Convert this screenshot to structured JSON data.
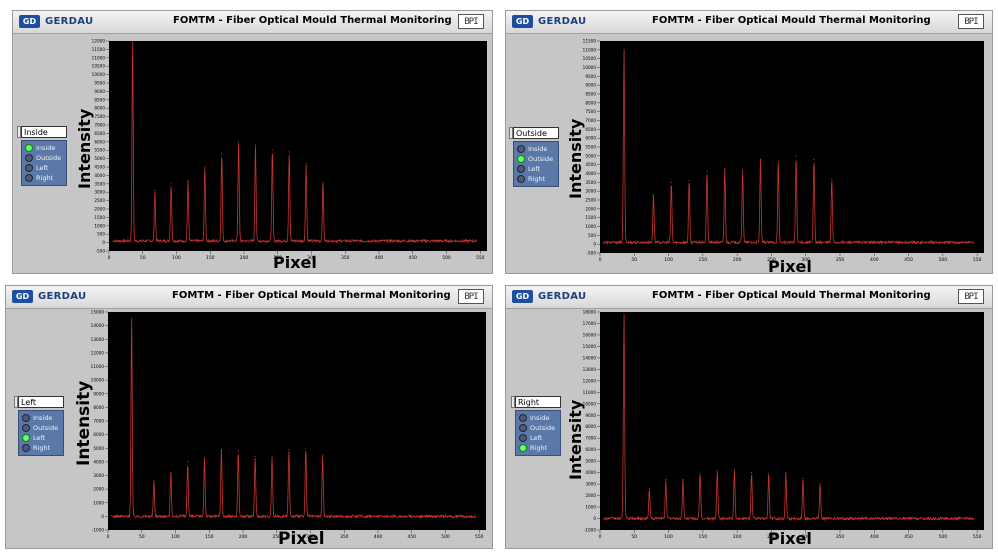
{
  "colors": {
    "plot_bg": "#000000",
    "trace": "#c8352f",
    "tick_text": "#000000"
  },
  "panels": [
    {
      "brand": "GERDAU",
      "logo_text": "GD",
      "title": "FOMTM - Fiber Optical Mould Thermal Monitoring",
      "corner_icon": "BPI-logo-icon",
      "selector": {
        "value": "Inside",
        "options": [
          {
            "label": "Inside",
            "active": true
          },
          {
            "label": "Outside",
            "active": false
          },
          {
            "label": "Left",
            "active": false
          },
          {
            "label": "Right",
            "active": false
          }
        ]
      },
      "chart_data": {
        "type": "line",
        "xlabel": "Pixel",
        "ylabel": "Intensity",
        "xlim": [
          0,
          500
        ],
        "ylim": [
          -500,
          12000
        ],
        "x_ticks": [
          0,
          50,
          100,
          150,
          200,
          250,
          300,
          350,
          400,
          450,
          500,
          550
        ],
        "y_ticks": [
          -500,
          0,
          500,
          1000,
          1500,
          2000,
          2500,
          3000,
          3500,
          4000,
          4500,
          5000,
          5500,
          6000,
          6500,
          7000,
          7500,
          8000,
          8500,
          9000,
          9500,
          10000,
          10500,
          11000,
          11500,
          12000
        ],
        "baseline": 100,
        "peaks": [
          {
            "x": 35,
            "y": 11900
          },
          {
            "x": 68,
            "y": 3100
          },
          {
            "x": 92,
            "y": 3500
          },
          {
            "x": 117,
            "y": 3700
          },
          {
            "x": 142,
            "y": 4500
          },
          {
            "x": 167,
            "y": 5300
          },
          {
            "x": 192,
            "y": 6000
          },
          {
            "x": 217,
            "y": 5800
          },
          {
            "x": 242,
            "y": 5500
          },
          {
            "x": 267,
            "y": 5400
          },
          {
            "x": 292,
            "y": 4700
          },
          {
            "x": 317,
            "y": 3600
          }
        ]
      }
    },
    {
      "brand": "GERDAU",
      "logo_text": "GD",
      "title": "FOMTM - Fiber Optical Mould Thermal Monitoring",
      "corner_icon": "BPI-logo-icon",
      "selector": {
        "value": "Outside",
        "options": [
          {
            "label": "Inside",
            "active": false
          },
          {
            "label": "Outside",
            "active": true
          },
          {
            "label": "Left",
            "active": false
          },
          {
            "label": "Right",
            "active": false
          }
        ]
      },
      "chart_data": {
        "type": "line",
        "xlabel": "Pixel",
        "ylabel": "Intensity",
        "xlim": [
          0,
          500
        ],
        "ylim": [
          -500,
          11500
        ],
        "x_ticks": [
          0,
          50,
          100,
          150,
          200,
          250,
          300,
          350,
          400,
          450,
          500,
          550
        ],
        "y_ticks": [
          -500,
          0,
          500,
          1000,
          1500,
          2000,
          2500,
          3000,
          3500,
          4000,
          4500,
          5000,
          5500,
          6000,
          6500,
          7000,
          7500,
          8000,
          8500,
          9000,
          9500,
          10000,
          10500,
          11000,
          11500
        ],
        "baseline": 100,
        "peaks": [
          {
            "x": 35,
            "y": 11000
          },
          {
            "x": 78,
            "y": 2800
          },
          {
            "x": 104,
            "y": 3500
          },
          {
            "x": 130,
            "y": 3600
          },
          {
            "x": 156,
            "y": 4100
          },
          {
            "x": 182,
            "y": 4300
          },
          {
            "x": 208,
            "y": 4200
          },
          {
            "x": 234,
            "y": 4800
          },
          {
            "x": 260,
            "y": 4700
          },
          {
            "x": 286,
            "y": 5000
          },
          {
            "x": 312,
            "y": 4800
          },
          {
            "x": 338,
            "y": 3700
          }
        ]
      }
    },
    {
      "brand": "GERDAU",
      "logo_text": "GD",
      "title": "FOMTM - Fiber Optical Mould Thermal Monitoring",
      "corner_icon": "BPI-logo-icon",
      "selector": {
        "value": "Left",
        "options": [
          {
            "label": "Inside",
            "active": false
          },
          {
            "label": "Outside",
            "active": false
          },
          {
            "label": "Left",
            "active": true
          },
          {
            "label": "Right",
            "active": false
          }
        ]
      },
      "chart_data": {
        "type": "line",
        "xlabel": "Pixel",
        "ylabel": "Intensity",
        "xlim": [
          0,
          500
        ],
        "ylim": [
          -1000,
          15000
        ],
        "x_ticks": [
          0,
          50,
          100,
          150,
          200,
          250,
          300,
          350,
          400,
          450,
          500,
          550
        ],
        "y_ticks": [
          -1000,
          0,
          1000,
          2000,
          3000,
          4000,
          5000,
          6000,
          7000,
          8000,
          9000,
          10000,
          11000,
          12000,
          13000,
          14000,
          15000
        ],
        "baseline": 0,
        "peaks": [
          {
            "x": 35,
            "y": 14500
          },
          {
            "x": 68,
            "y": 2600
          },
          {
            "x": 93,
            "y": 3200
          },
          {
            "x": 118,
            "y": 4000
          },
          {
            "x": 143,
            "y": 4300
          },
          {
            "x": 168,
            "y": 4900
          },
          {
            "x": 193,
            "y": 4800
          },
          {
            "x": 218,
            "y": 4400
          },
          {
            "x": 243,
            "y": 4400
          },
          {
            "x": 268,
            "y": 4900
          },
          {
            "x": 293,
            "y": 5000
          },
          {
            "x": 318,
            "y": 4500
          }
        ]
      }
    },
    {
      "brand": "GERDAU",
      "logo_text": "GD",
      "title": "FOMTM - Fiber Optical Mould Thermal Monitoring",
      "corner_icon": "BPI-logo-icon",
      "selector": {
        "value": "Right",
        "options": [
          {
            "label": "Inside",
            "active": false
          },
          {
            "label": "Outside",
            "active": false
          },
          {
            "label": "Left",
            "active": false
          },
          {
            "label": "Right",
            "active": true
          }
        ]
      },
      "chart_data": {
        "type": "line",
        "xlabel": "Pixel",
        "ylabel": "Intensity",
        "xlim": [
          0,
          500
        ],
        "ylim": [
          -1000,
          18000
        ],
        "x_ticks": [
          0,
          50,
          100,
          150,
          200,
          250,
          300,
          350,
          400,
          450,
          500,
          550
        ],
        "y_ticks": [
          -1000,
          0,
          1000,
          2000,
          3000,
          4000,
          5000,
          6000,
          7000,
          8000,
          9000,
          10000,
          11000,
          12000,
          13000,
          14000,
          15000,
          16000,
          17000,
          18000
        ],
        "baseline": 0,
        "peaks": [
          {
            "x": 35,
            "y": 17800
          },
          {
            "x": 72,
            "y": 2600
          },
          {
            "x": 96,
            "y": 3400
          },
          {
            "x": 121,
            "y": 3400
          },
          {
            "x": 146,
            "y": 3900
          },
          {
            "x": 171,
            "y": 4200
          },
          {
            "x": 196,
            "y": 4300
          },
          {
            "x": 221,
            "y": 4000
          },
          {
            "x": 246,
            "y": 3900
          },
          {
            "x": 271,
            "y": 4000
          },
          {
            "x": 296,
            "y": 3500
          },
          {
            "x": 321,
            "y": 3000
          }
        ]
      }
    }
  ]
}
